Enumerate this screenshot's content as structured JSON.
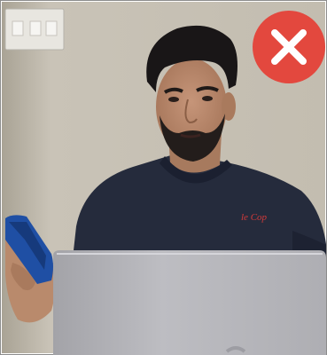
{
  "image": {
    "subject": "person-with-phone-and-laptop",
    "overlay_icon": "close-icon",
    "colors": {
      "wall": "#c9c3b7",
      "wall_shadow": "#a9a395",
      "shirt": "#252b3c",
      "skin": "#b98a6c",
      "hair": "#191617",
      "laptop": "#b6b6bb",
      "phone": "#1f4fa4",
      "close_badge": "#e3483e",
      "close_x": "#ffffff",
      "logo_red": "#d33a3a"
    }
  }
}
